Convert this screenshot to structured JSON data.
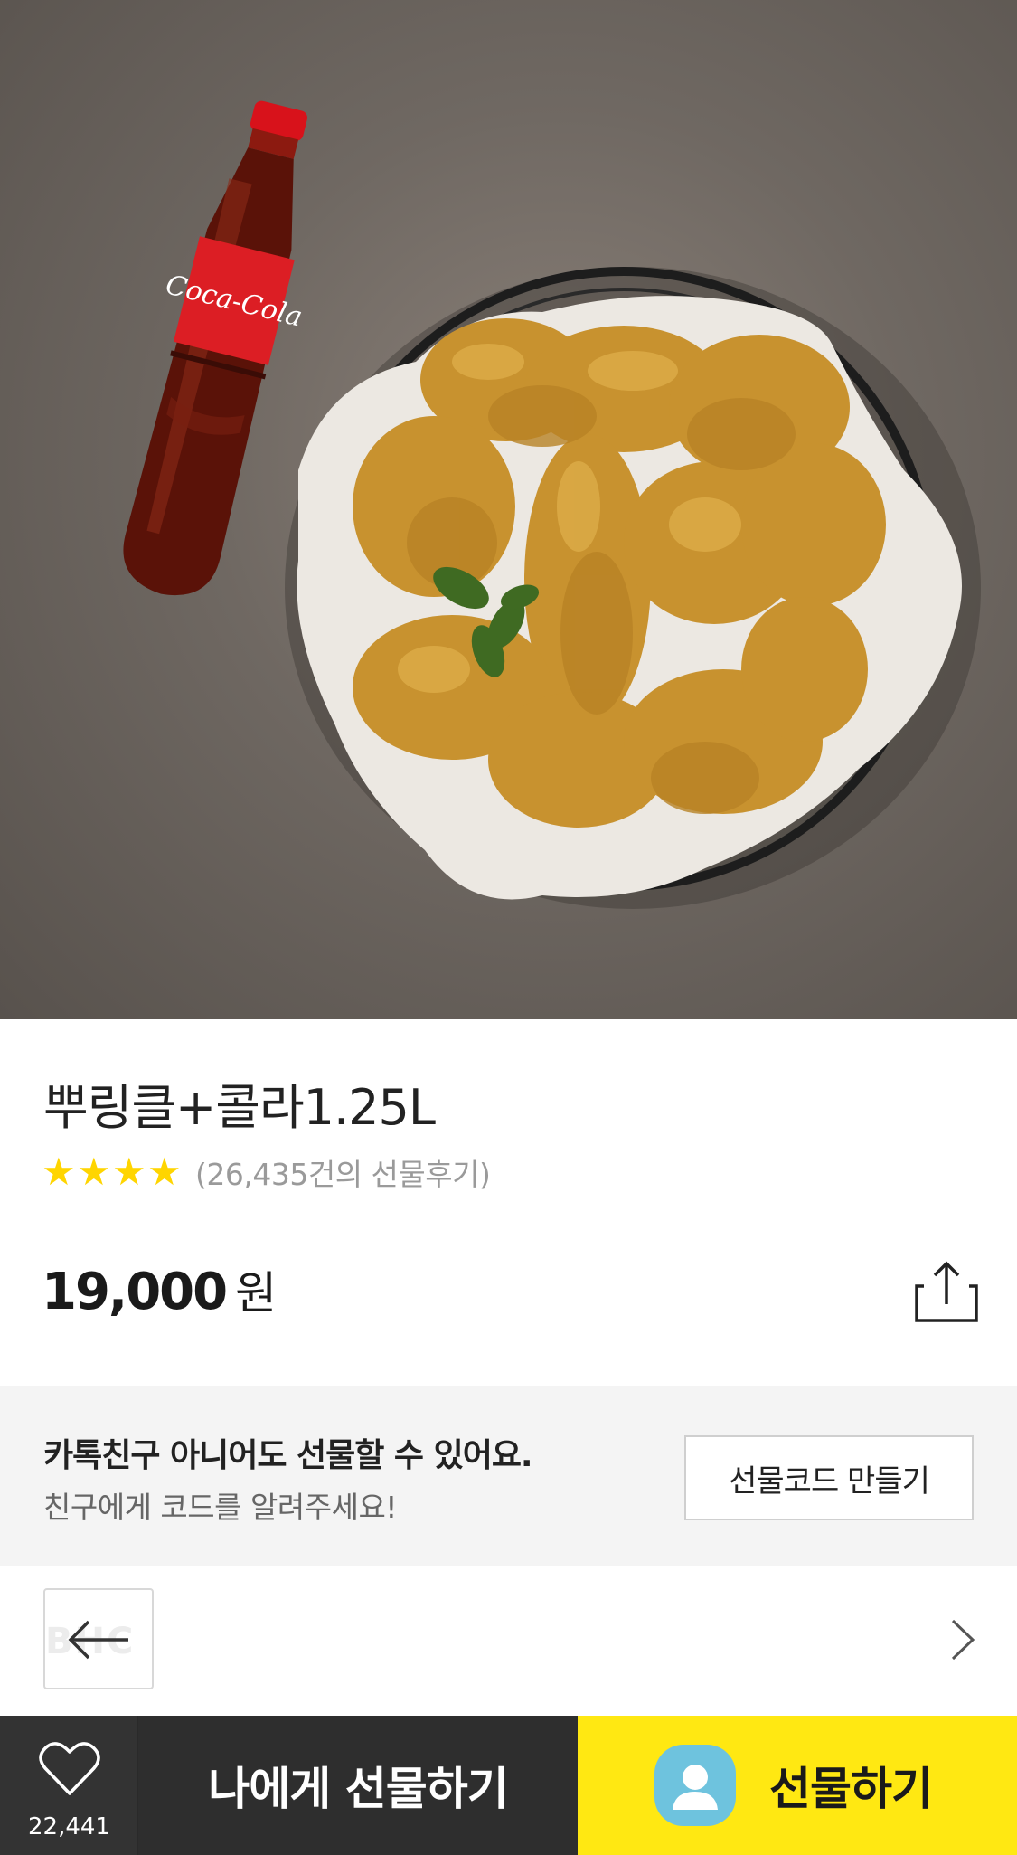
{
  "product": {
    "image_alt": "뿌링클+콜라1.25L",
    "title": "뿌링클+콜라1.25L",
    "rating_stars": 4,
    "review_text": "(26,435건의 선물후기)",
    "price_value": "19,000",
    "price_unit": "원",
    "share_icon": "share-icon"
  },
  "banner": {
    "title": "카톡친구 아니어도 선물할 수 있어요.",
    "subtitle": "친구에게 코드를 알려주세요!",
    "code_button_label": "선물코드 만들기"
  },
  "brand_row": {
    "thumb_icon": "back-arrow-icon",
    "next_icon": "chevron-right-icon"
  },
  "bottom_bar": {
    "like_icon": "heart-icon",
    "like_count": "22,441",
    "self_gift_label": "나에게 선물하기",
    "gift_label": "선물하기"
  },
  "colors": {
    "star": "#ffd500",
    "gift_yellow": "#ffe812",
    "dark_bar": "#2e2e2e",
    "banner_bg": "#f4f4f4",
    "avatar_blue": "#6ec3de"
  }
}
